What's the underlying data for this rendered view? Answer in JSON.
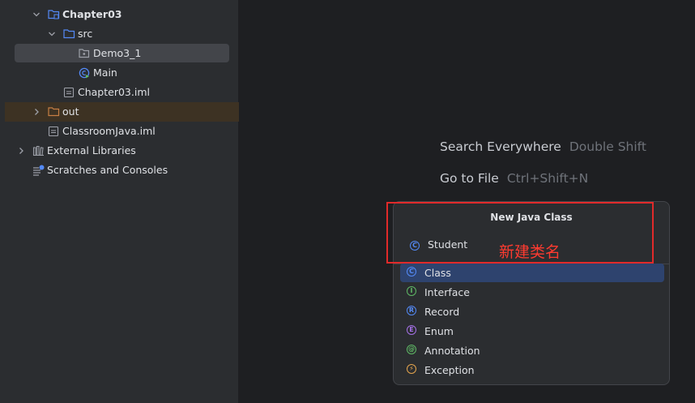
{
  "project_tree": {
    "rows": [
      {
        "label": "Chapter03",
        "bold": true,
        "icon": "module-folder-icon"
      },
      {
        "label": "src",
        "icon": "source-folder-icon"
      },
      {
        "label": "Demo3_1",
        "icon": "package-icon"
      },
      {
        "label": "Main",
        "icon": "java-class-run-icon"
      },
      {
        "label": "Chapter03.iml",
        "icon": "iml-file-icon"
      },
      {
        "label": "out",
        "icon": "excluded-folder-icon"
      },
      {
        "label": "ClassroomJava.iml",
        "icon": "iml-file-icon"
      },
      {
        "label": "External Libraries",
        "icon": "libraries-icon"
      },
      {
        "label": "Scratches and Consoles",
        "icon": "scratches-icon"
      }
    ]
  },
  "hints": [
    {
      "action": "Search Everywhere",
      "key": "Double Shift"
    },
    {
      "action": "Go to File",
      "key": "Ctrl+Shift+N"
    }
  ],
  "popup": {
    "title": "New Java Class",
    "input_value": "Student",
    "kinds": [
      {
        "label": "Class",
        "letter": "C",
        "color": "#548af7",
        "selected": true
      },
      {
        "label": "Interface",
        "letter": "I",
        "color": "#5fb865",
        "selected": false
      },
      {
        "label": "Record",
        "letter": "R",
        "color": "#548af7",
        "selected": false
      },
      {
        "label": "Enum",
        "letter": "E",
        "color": "#a571e6",
        "selected": false
      },
      {
        "label": "Annotation",
        "letter": "@",
        "color": "#5fb865",
        "selected": false
      },
      {
        "label": "Exception",
        "letter": "⚡",
        "color": "#e5a54e",
        "selected": false
      }
    ]
  },
  "annotation": {
    "text": "新建类名",
    "color": "#e12a2a"
  },
  "colors": {
    "accent": "#2e436e",
    "folder_blue": "#548af7",
    "excluded_orange": "#c67e43"
  }
}
